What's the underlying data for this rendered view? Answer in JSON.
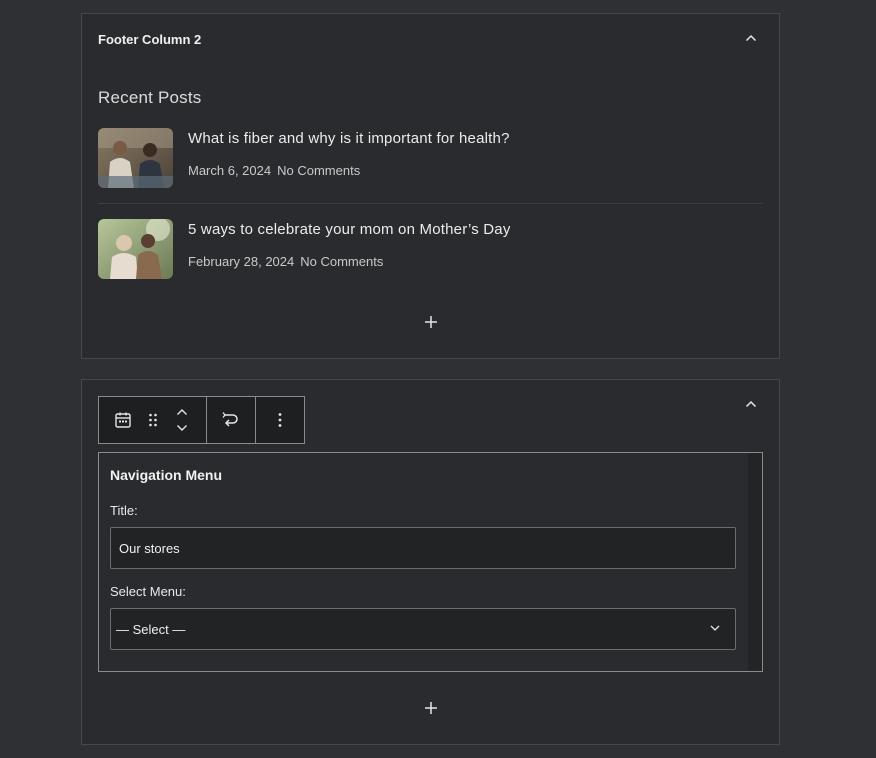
{
  "panel1": {
    "title": "Footer Column 2",
    "widget_heading": "Recent Posts",
    "posts": [
      {
        "title": "What is fiber and why is it important for health?",
        "date": "March 6, 2024",
        "comments": "No Comments"
      },
      {
        "title": "5 ways to celebrate your mom on Mother’s Day",
        "date": "February 28, 2024",
        "comments": "No Comments"
      }
    ],
    "add_block_icon": "plus-icon"
  },
  "panel2": {
    "toolbar": {
      "block_icon": "calendar-icon",
      "drag_icon": "drag-handle-icon",
      "move_icons": [
        "chevron-up-icon",
        "chevron-down-icon"
      ],
      "transform_icon": "transform-icon",
      "options_icon": "more-vertical-icon"
    },
    "widget": {
      "title": "Navigation Menu",
      "title_label": "Title:",
      "title_value": "Our stores",
      "menu_label": "Select Menu:",
      "menu_selected": "— Select —"
    },
    "add_block_icon": "plus-icon"
  },
  "colors": {
    "background": "#2f3033",
    "panel": "#2a2b2e",
    "border": "#46474b",
    "text": "#e6e6e6"
  }
}
